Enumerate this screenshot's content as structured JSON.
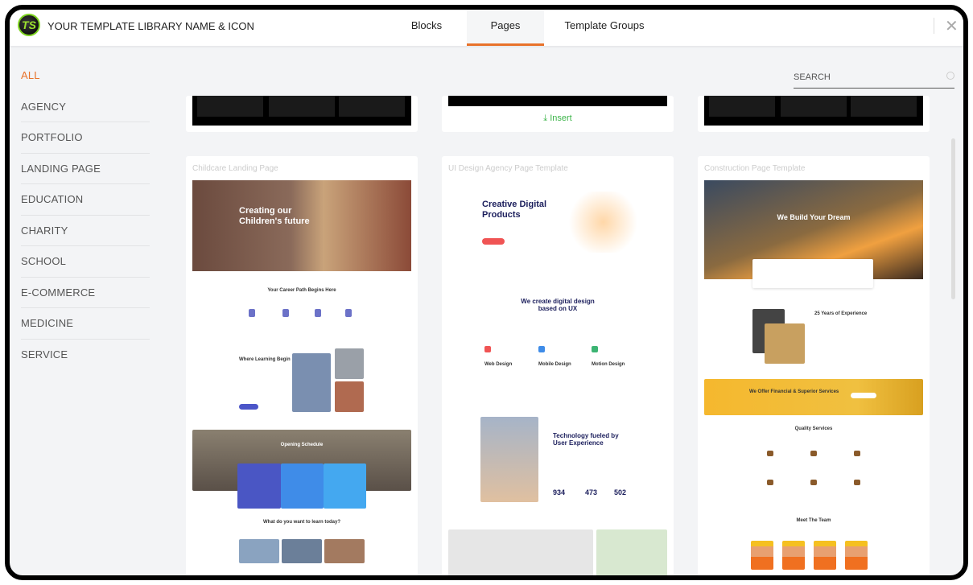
{
  "header": {
    "title": "YOUR TEMPLATE LIBRARY NAME & ICON",
    "logo_text": "TS",
    "tabs": [
      {
        "label": "Blocks"
      },
      {
        "label": "Pages",
        "active": true
      },
      {
        "label": "Template Groups"
      }
    ],
    "close_icon": "close-icon"
  },
  "sidebar": {
    "items": [
      {
        "label": "ALL",
        "active": true
      },
      {
        "label": "AGENCY"
      },
      {
        "label": "PORTFOLIO"
      },
      {
        "label": "LANDING PAGE"
      },
      {
        "label": "EDUCATION"
      },
      {
        "label": "CHARITY"
      },
      {
        "label": "SCHOOL"
      },
      {
        "label": "E-COMMERCE"
      },
      {
        "label": "MEDICINE"
      },
      {
        "label": "SERVICE"
      }
    ]
  },
  "search": {
    "placeholder": "SEARCH"
  },
  "insert_label": "Insert",
  "accent": "#e8722a",
  "insert_color": "#3cb449",
  "cards": [
    {
      "title": "Childcare Landing Page",
      "headline": "Creating our Children's future",
      "section": "Your Career Path Begins Here",
      "section2": "Where Learning Begin",
      "section3": "Opening Schedule",
      "section4": "What do you want to learn today?"
    },
    {
      "title": "UI Design Agency Page Template",
      "headline": "Creative Digital Products",
      "section": "We create digital design based on UX",
      "services": [
        "Web Design",
        "Mobile Design",
        "Motion Design"
      ],
      "section2": "Technology fueled by User Experience",
      "stats": [
        "934",
        "473",
        "502"
      ]
    },
    {
      "title": "Construction Page Template",
      "headline": "We Build Your Dream",
      "section": "25 Years of Experience",
      "section2": "We Offer Financial & Superior Services",
      "section3": "Quality Services",
      "section4": "Meet The Team"
    }
  ]
}
